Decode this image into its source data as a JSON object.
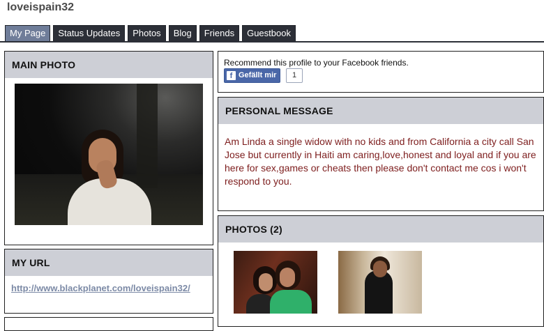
{
  "profile": {
    "username": "loveispain32"
  },
  "tabs": [
    {
      "label": "My Page"
    },
    {
      "label": "Status Updates"
    },
    {
      "label": "Photos"
    },
    {
      "label": "Blog"
    },
    {
      "label": "Friends"
    },
    {
      "label": "Guestbook"
    }
  ],
  "main_photo": {
    "title": "MAIN PHOTO"
  },
  "my_url": {
    "title": "MY URL",
    "link": "http://www.blackplanet.com/loveispain32/"
  },
  "recommend": {
    "text": "Recommend this profile to your Facebook friends.",
    "button_label": "Gefällt mir",
    "count": "1"
  },
  "personal_message": {
    "title": "PERSONAL MESSAGE",
    "text": "Am Linda a single widow with no kids and from California a city call San Jose but currently in Haiti am caring,love,honest and loyal and if you are here for sex,games or cheats then please don't contact me cos i won't respond to you."
  },
  "photos": {
    "title": "PHOTOS (2)"
  },
  "colors": {
    "tab_bg": "#2c2f37",
    "tab_active": "#6f7d99",
    "panel_header": "#cdcfd6",
    "message_text": "#7d1d1d",
    "link": "#7c8aa6",
    "facebook_blue": "#4a67a8"
  },
  "icons": {
    "facebook": "facebook-icon"
  }
}
